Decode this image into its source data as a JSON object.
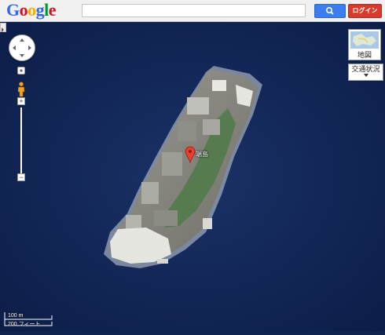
{
  "header": {
    "logo_letters": [
      {
        "char": "G",
        "color": "#3369e8"
      },
      {
        "char": "o",
        "color": "#d50f25"
      },
      {
        "char": "o",
        "color": "#eeb211"
      },
      {
        "char": "g",
        "color": "#3369e8"
      },
      {
        "char": "l",
        "color": "#009925"
      },
      {
        "char": "e",
        "color": "#d50f25"
      }
    ],
    "search_placeholder": "",
    "search_icon": "search-icon",
    "login_label": "ログイン",
    "login_color": "#d93a2c",
    "search_button_color": "#3c7ef0"
  },
  "map": {
    "type_control_label": "地図",
    "traffic_label": "交通状況",
    "marker_label": "端島",
    "scale_metric": "100 m",
    "scale_imperial": "200 フィート"
  },
  "controls": {
    "zoom_in_label": "+",
    "zoom_out_label": "−"
  }
}
